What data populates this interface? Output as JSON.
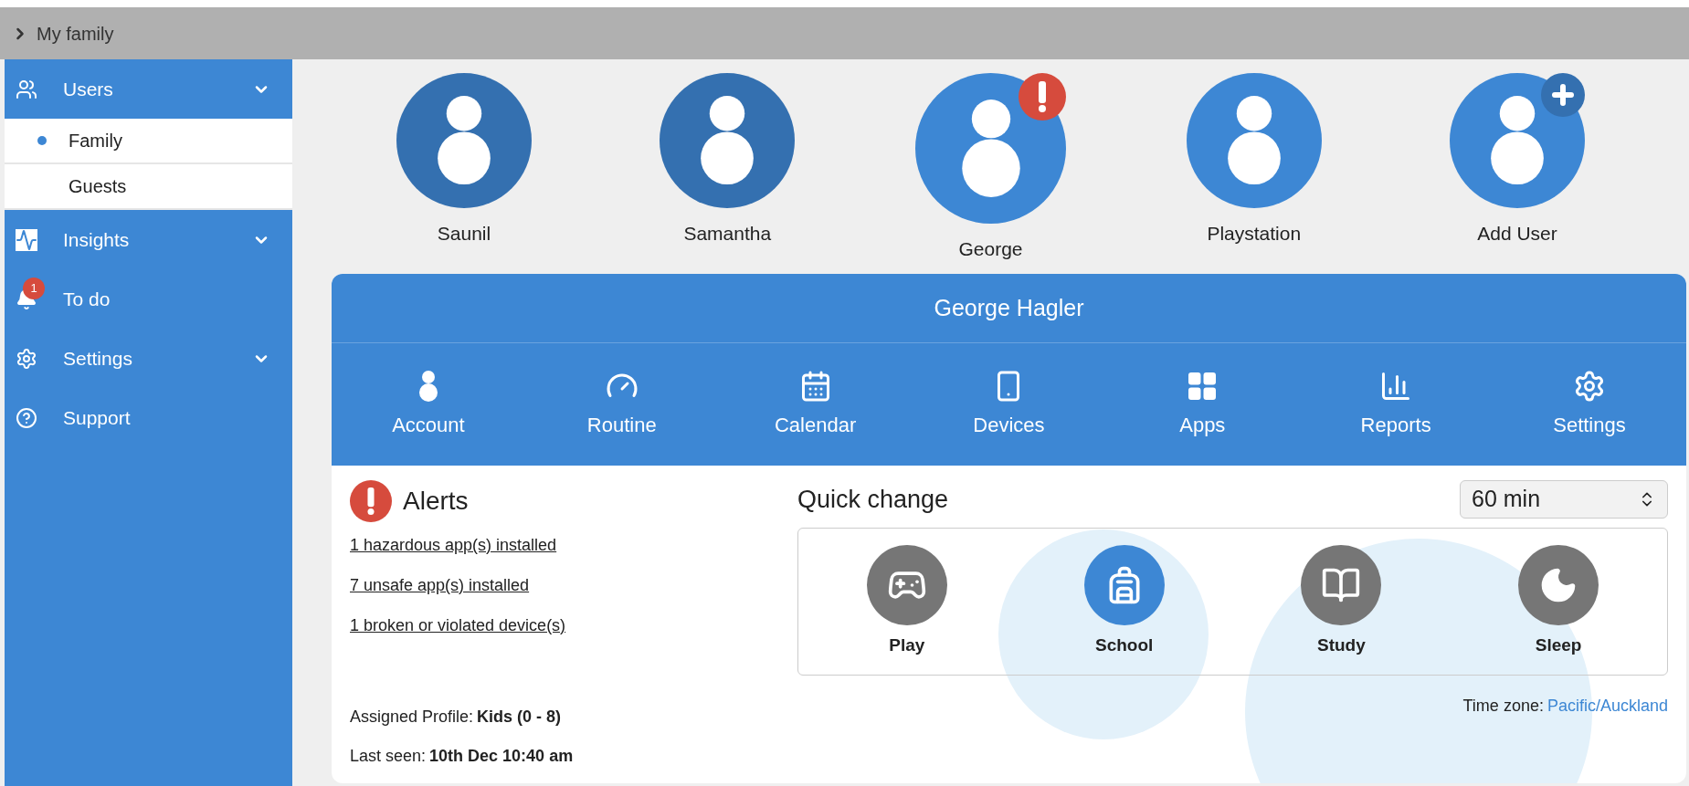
{
  "breadcrumb": {
    "label": "My family"
  },
  "sidebar": {
    "items": [
      {
        "label": "Users",
        "kind": "users",
        "chevron": true,
        "children": [
          {
            "label": "Family",
            "selected": true
          },
          {
            "label": "Guests",
            "selected": false
          }
        ]
      },
      {
        "label": "Insights",
        "kind": "insights",
        "chevron": true
      },
      {
        "label": "To do",
        "kind": "todo",
        "badge": "1"
      },
      {
        "label": "Settings",
        "kind": "settings",
        "chevron": true
      },
      {
        "label": "Support",
        "kind": "support"
      }
    ]
  },
  "users": [
    {
      "name": "Saunil",
      "kind": "user",
      "selected": false,
      "color": "#3470b0"
    },
    {
      "name": "Samantha",
      "kind": "user",
      "selected": false,
      "color": "#3470b0"
    },
    {
      "name": "George",
      "kind": "flagged",
      "selected": true,
      "color": "#3d87d4"
    },
    {
      "name": "Playstation",
      "kind": "user",
      "selected": false,
      "color": "#3d87d4"
    },
    {
      "name": "Add User",
      "kind": "add",
      "selected": false,
      "color": "#3d87d4"
    }
  ],
  "profile": {
    "title": "George Hagler",
    "tabs": [
      {
        "label": "Account",
        "kind": "account"
      },
      {
        "label": "Routine",
        "kind": "routine"
      },
      {
        "label": "Calendar",
        "kind": "calendar"
      },
      {
        "label": "Devices",
        "kind": "devices"
      },
      {
        "label": "Apps",
        "kind": "apps"
      },
      {
        "label": "Reports",
        "kind": "reports"
      },
      {
        "label": "Settings",
        "kind": "settings"
      }
    ],
    "alerts": {
      "title": "Alerts",
      "links": [
        "1 hazardous app(s) installed",
        "7 unsafe app(s) installed",
        "1 broken or violated device(s)"
      ]
    },
    "assigned_profile": {
      "label": "Assigned Profile:",
      "value": "Kids (0 - 8)"
    },
    "last_seen": {
      "label": "Last seen:",
      "value": "10th Dec 10:40 am"
    },
    "quick_change": {
      "title": "Quick change",
      "duration": "60 min",
      "modes": [
        {
          "label": "Play",
          "kind": "play",
          "selected": false
        },
        {
          "label": "School",
          "kind": "school",
          "selected": true
        },
        {
          "label": "Study",
          "kind": "study",
          "selected": false
        },
        {
          "label": "Sleep",
          "kind": "sleep",
          "selected": false
        }
      ]
    },
    "time_zone": {
      "label": "Time zone:",
      "value": "Pacific/Auckland"
    }
  }
}
